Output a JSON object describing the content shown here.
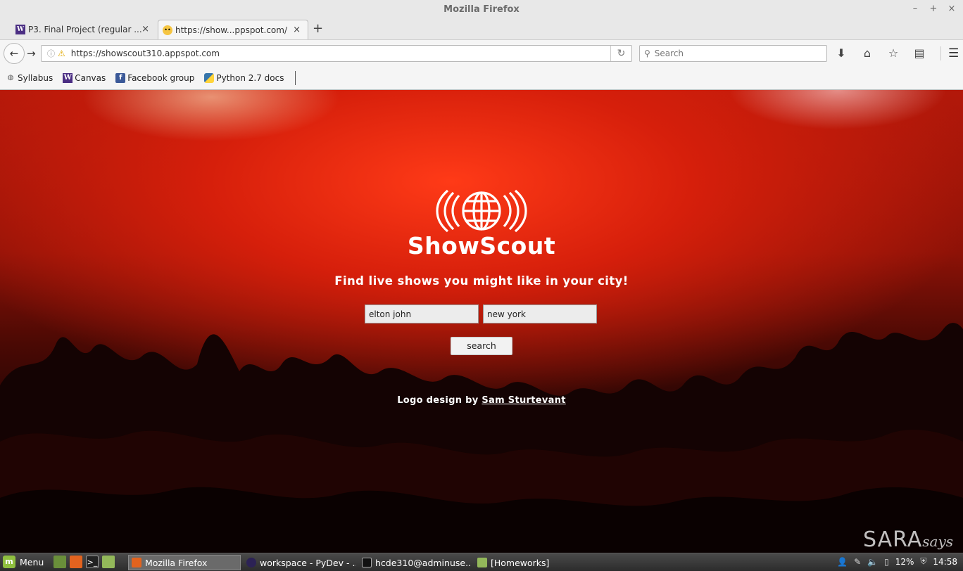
{
  "window": {
    "title": "Mozilla Firefox"
  },
  "tabs": [
    {
      "label": "P3. Final Project (regular ...",
      "favicon": "canvas-w-icon",
      "active": false
    },
    {
      "label": "https://show...ppspot.com/",
      "favicon": "smiley-icon",
      "active": true
    }
  ],
  "nav": {
    "url": "https://showscout310.appspot.com",
    "search_placeholder": "Search"
  },
  "bookmarks": [
    {
      "label": "Syllabus",
      "icon": "globe-icon"
    },
    {
      "label": "Canvas",
      "icon": "canvas-w-icon"
    },
    {
      "label": "Facebook group",
      "icon": "facebook-icon"
    },
    {
      "label": "Python 2.7 docs",
      "icon": "python-icon"
    }
  ],
  "page": {
    "brand": "ShowScout",
    "tagline": "Find live shows you might like in your city!",
    "artist_value": "elton john",
    "city_value": "new york",
    "search_button": "search",
    "credit_prefix": "Logo design by",
    "credit_link": "Sam Sturtevant",
    "watermark_main": "SARA",
    "watermark_script": "says",
    "accent": "#d61f0b"
  },
  "taskbar": {
    "menu_label": "Menu",
    "tasks": [
      {
        "label": "Mozilla Firefox",
        "icon": "firefox-icon",
        "active": true
      },
      {
        "label": "workspace - PyDev - ...",
        "icon": "eclipse-icon",
        "active": false
      },
      {
        "label": "hcde310@adminuse...",
        "icon": "terminal-icon",
        "active": false
      },
      {
        "label": "[Homeworks]",
        "icon": "folder-icon",
        "active": false
      }
    ],
    "battery": "12%",
    "clock": "14:58"
  }
}
